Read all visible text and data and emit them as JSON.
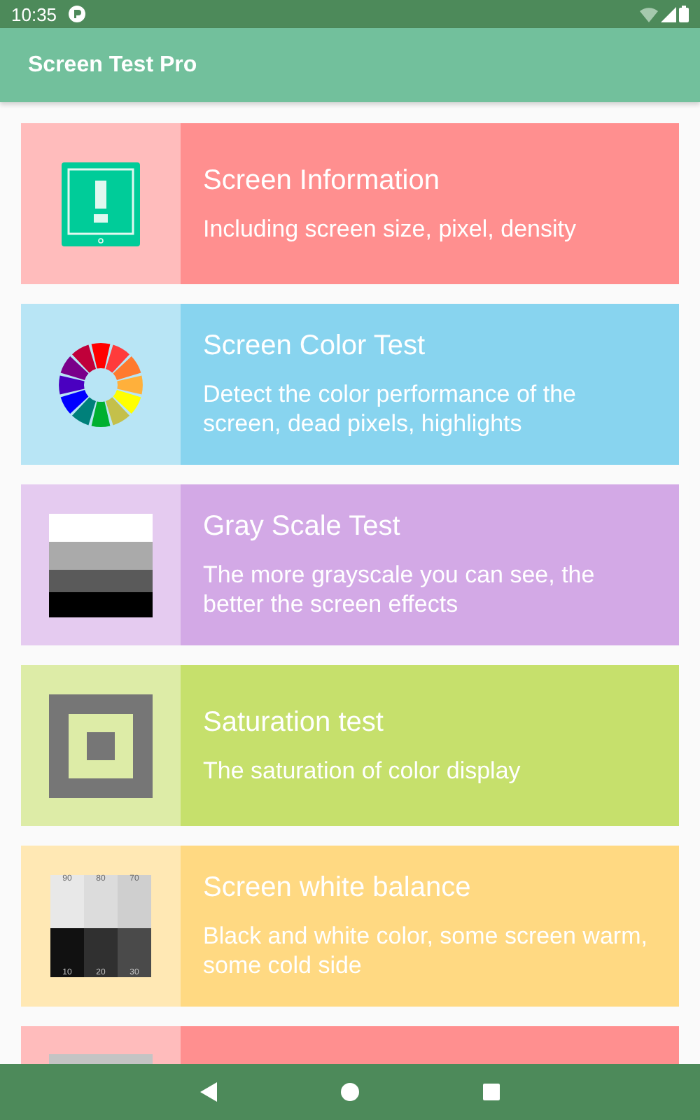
{
  "status_bar": {
    "time": "10:35"
  },
  "app_bar": {
    "title": "Screen Test Pro"
  },
  "items": [
    {
      "kind": "info",
      "title": "Screen Information",
      "description": "Including screen size, pixel, density",
      "color": "#ff8f8f"
    },
    {
      "kind": "color-wheel",
      "title": "Screen Color Test",
      "description": "Detect the color performance of the screen, dead pixels, highlights",
      "color": "#88d4ef"
    },
    {
      "kind": "grayscale",
      "title": "Gray Scale Test",
      "description": "The more grayscale you can see, the better the screen effects",
      "color": "#d3a9e6"
    },
    {
      "kind": "saturation",
      "title": "Saturation test",
      "description": "The saturation of color display",
      "color": "#c6e06c"
    },
    {
      "kind": "white-balance",
      "title": "Screen white balance",
      "description": "Black and white color, some screen warm, some cold side",
      "color": "#ffd982",
      "labels": [
        "90",
        "80",
        "70",
        "10",
        "20",
        "30"
      ]
    },
    {
      "kind": "multi-touch",
      "color": "#ff8f8f"
    }
  ]
}
